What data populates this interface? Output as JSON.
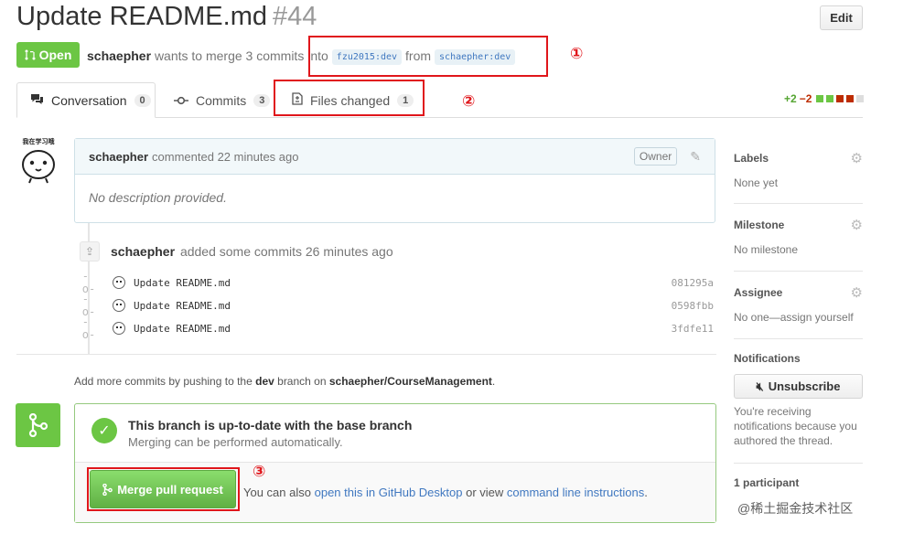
{
  "header": {
    "title": "Update README.md",
    "number": "#44",
    "edit_label": "Edit"
  },
  "state": {
    "label": "Open",
    "color": "#6cc644"
  },
  "meta": {
    "author": "schaepher",
    "text": "wants to merge 3 commits",
    "into_word": "into",
    "base_branch": "fzu2015:dev",
    "from_word": "from",
    "head_branch": "schaepher:dev"
  },
  "annotations": [
    "①",
    "②",
    "③"
  ],
  "tabs": [
    {
      "label": "Conversation",
      "count": "0",
      "icon": "comment-discussion-icon"
    },
    {
      "label": "Commits",
      "count": "3",
      "icon": "git-commit-icon"
    },
    {
      "label": "Files changed",
      "count": "1",
      "icon": "diff-icon"
    }
  ],
  "diffstat": {
    "additions": "+2",
    "deletions": "−2"
  },
  "avatar": {
    "caption": "我在学习哦"
  },
  "comment": {
    "author": "schaepher",
    "action": "commented 22 minutes ago",
    "badge": "Owner",
    "body": "No description provided."
  },
  "commits_summary": {
    "author": "schaepher",
    "text": "added some commits 26 minutes ago"
  },
  "commits": [
    {
      "message": "Update README.md",
      "sha": "081295a"
    },
    {
      "message": "Update README.md",
      "sha": "0598fbb"
    },
    {
      "message": "Update README.md",
      "sha": "3fdfe11"
    }
  ],
  "push_hint": {
    "pre": "Add more commits by pushing to the",
    "branch": "dev",
    "mid": "branch on",
    "repo": "schaepher/CourseManagement",
    "post": "."
  },
  "merge": {
    "title": "This branch is up-to-date with the base branch",
    "subtitle": "Merging can be performed automatically.",
    "button": "Merge pull request",
    "alt_pre": "You can also",
    "alt_link1": "open this in GitHub Desktop",
    "alt_mid": "or view",
    "alt_link2": "command line instructions",
    "alt_post": "."
  },
  "sidebar": {
    "labels": {
      "title": "Labels",
      "value": "None yet"
    },
    "milestone": {
      "title": "Milestone",
      "value": "No milestone"
    },
    "assignee": {
      "title": "Assignee",
      "value": "No one—assign yourself"
    },
    "notifications": {
      "title": "Notifications",
      "button": "Unsubscribe",
      "text": "You're receiving notifications because you authored the thread."
    },
    "participants": {
      "title": "1 participant"
    }
  },
  "watermark": "@稀土掘金技术社区"
}
